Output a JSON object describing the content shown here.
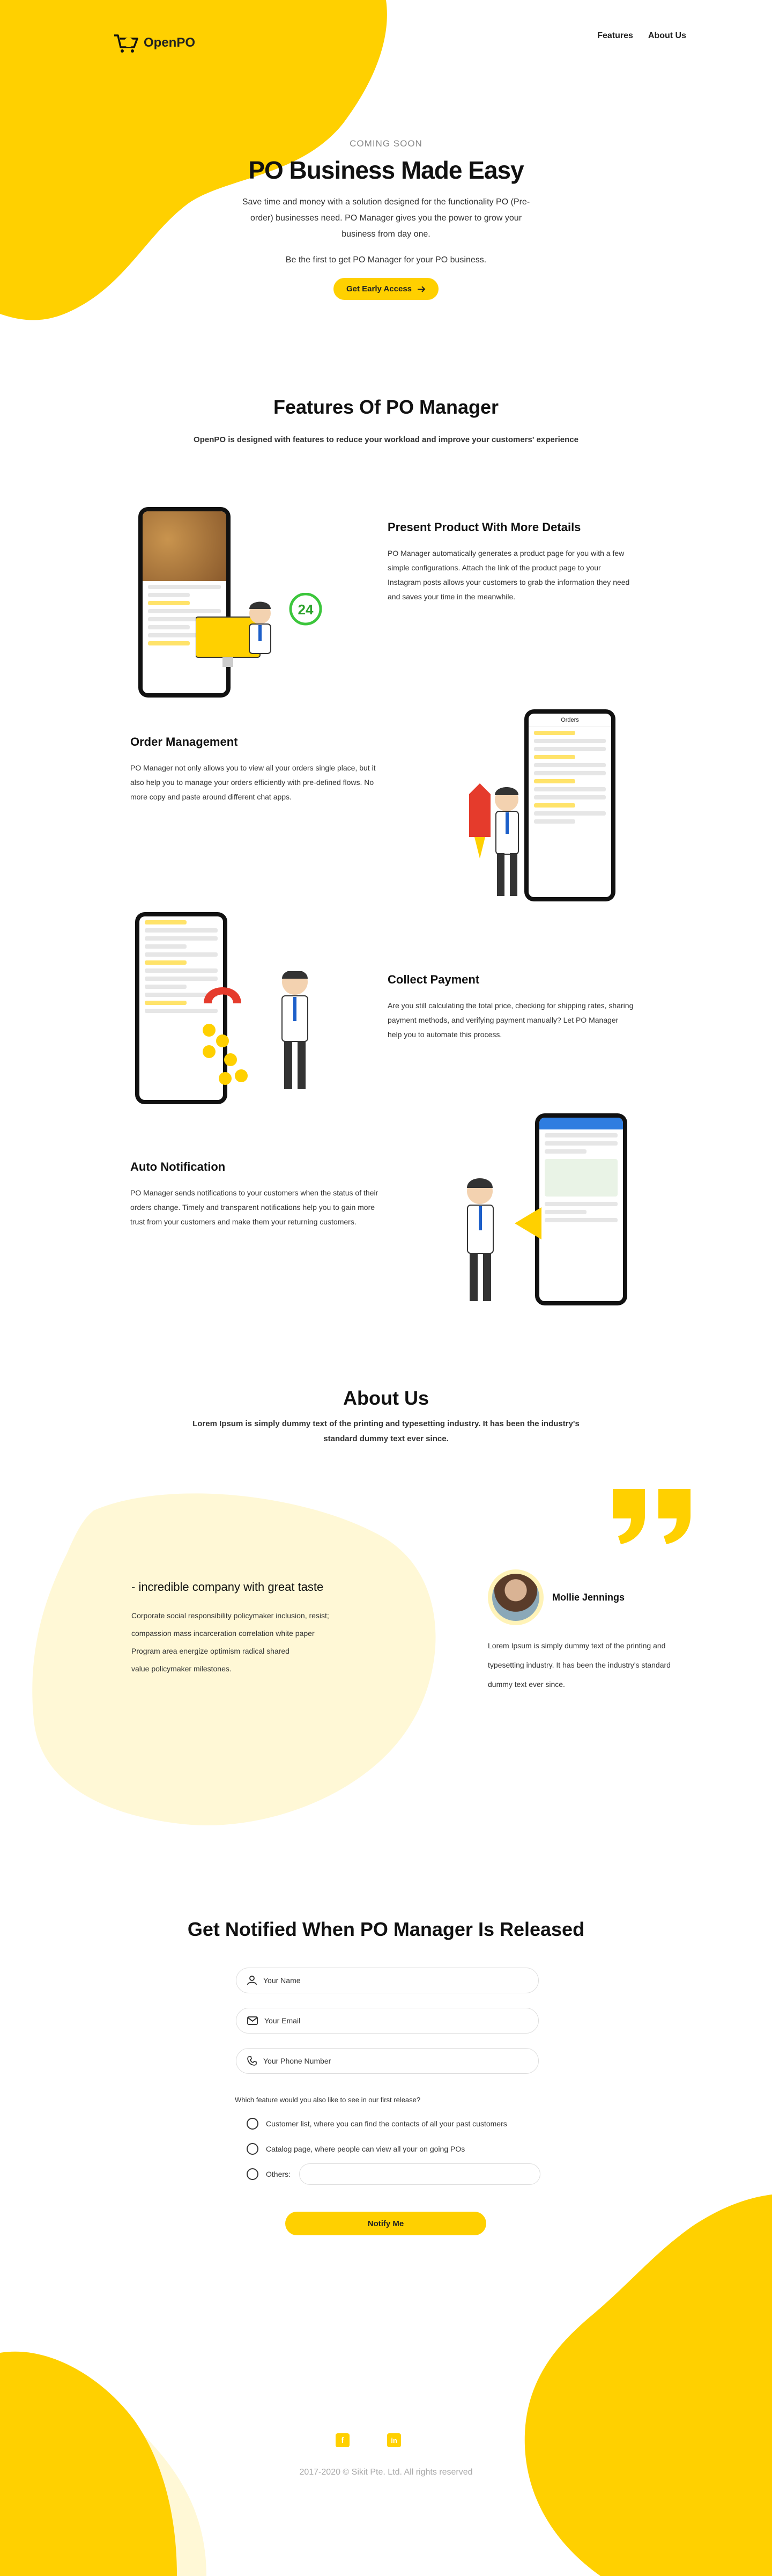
{
  "header": {
    "logo_text": "OpenPO",
    "nav": [
      "Features",
      "About Us"
    ]
  },
  "hero": {
    "eyebrow": "COMING SOON",
    "title": "PO Business Made Easy",
    "description": "Save time and money with a solution designed for the functionality PO (Pre-order) businesses need. PO Manager gives you the power to grow your business from day one.",
    "subtext": "Be the first to get PO Manager for your PO business.",
    "cta_label": "Get Early Access"
  },
  "features": {
    "title": "Features Of PO Manager",
    "subtitle": "OpenPO is designed with features to reduce your workload and improve your customers' experience",
    "items": [
      {
        "title": "Present Product With More Details",
        "text": "PO Manager automatically generates a product page for you with a few simple configurations. Attach the link of the product page to your Instagram posts allows your customers to grab the information they need and saves your time in the meanwhile."
      },
      {
        "title": "Order Management",
        "text": "PO Manager not only allows you to view all your orders single place, but it also help you to manage your orders efficiently with pre-defined flows. No more copy and paste around different chat apps."
      },
      {
        "title": "Collect Payment",
        "text": "Are you still calculating the total price, checking for shipping rates, sharing payment methods, and verifying payment manually? Let PO Manager help you to automate this process."
      },
      {
        "title": "Auto Notification",
        "text": "PO Manager sends notifications to your customers when the status of their orders change. Timely and transparent notifications help you to gain more trust from your customers and make them your returning customers."
      }
    ],
    "badge_number": "24",
    "phone_header": "Orders"
  },
  "about": {
    "title": "About Us",
    "subtitle": "Lorem Ipsum is simply dummy text of the printing and typesetting industry. It has been the industry's standard dummy text ever since.",
    "quote_title": "- incredible company with great taste",
    "quote_lines": [
      "Corporate social responsibility policymaker inclusion, resist;",
      "compassion mass incarceration correlation white paper",
      "Program area energize optimism radical shared",
      "value policymaker milestones."
    ],
    "person_name": "Mollie Jennings",
    "person_text": "Lorem Ipsum is simply dummy text of the printing and typesetting industry. It has been the industry's standard dummy text ever since."
  },
  "notify": {
    "title": "Get Notified When PO Manager Is Released",
    "name_placeholder": "Your Name",
    "email_placeholder": "Your Email",
    "phone_placeholder": "Your Phone Number",
    "question": "Which feature would you also like to see in our first release?",
    "options": [
      "Customer list, where you can find the contacts of all your past customers",
      "Catalog page, where people can view all your on going POs",
      "Others:"
    ],
    "button_label": "Notify Me"
  },
  "footer": {
    "copyright": "2017-2020 © Sikit Pte. Ltd. All rights reserved"
  },
  "colors": {
    "accent": "#FFD000",
    "pale": "#FFF8D6"
  },
  "icons": [
    "cart-logo-icon",
    "arrow-right-icon",
    "user-icon",
    "mail-icon",
    "phone-icon",
    "facebook-icon",
    "linkedin-icon",
    "quote-icon"
  ]
}
